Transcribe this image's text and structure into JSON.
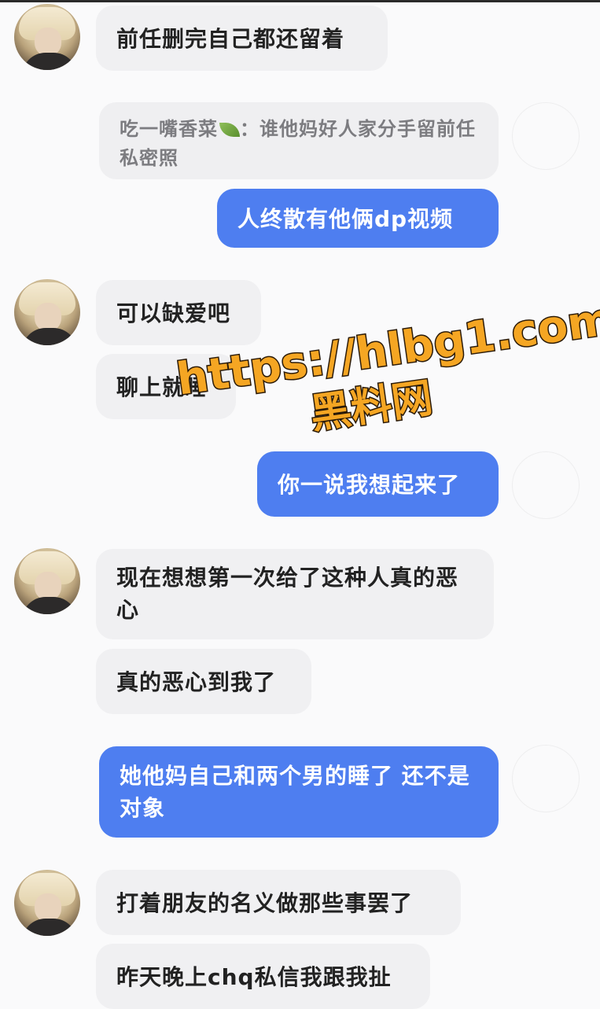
{
  "messages": [
    {
      "text": "前任删完自己都还留着"
    },
    {
      "quote_sender": "吃一嘴香菜",
      "quote_text": "谁他妈好人家分手留前任私密照"
    },
    {
      "text": "人终散有他俩dp视频"
    },
    {
      "text": "可以缺爱吧"
    },
    {
      "text": "聊上就睡"
    },
    {
      "text": "你一说我想起来了"
    },
    {
      "text": "现在想想第一次给了这种人真的恶心"
    },
    {
      "text": "真的恶心到我了"
    },
    {
      "text": "她他妈自己和两个男的睡了 还不是对象"
    },
    {
      "text": "打着朋友的名义做那些事罢了"
    },
    {
      "text": "昨天晚上chq私信我跟我扯"
    }
  ],
  "watermark": {
    "url": "https://hlbg1.com",
    "site": "黑料网"
  },
  "colors": {
    "outgoing_bubble": "#4e7ef0",
    "incoming_bubble": "#f0f0f2",
    "watermark": "#f5a623"
  }
}
